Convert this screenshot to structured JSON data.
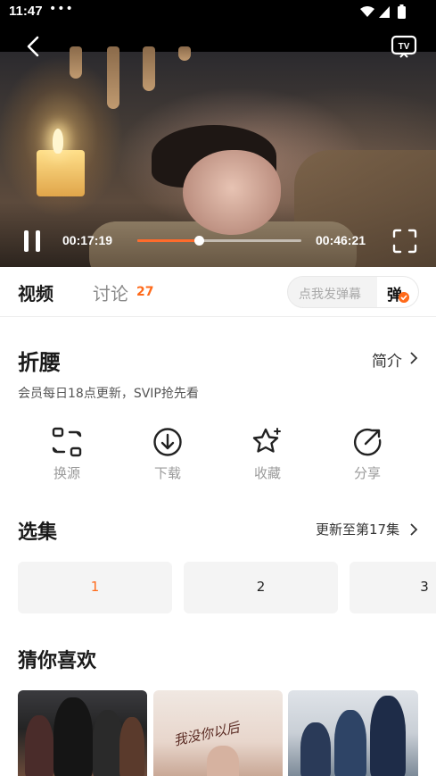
{
  "status_bar": {
    "time": "11:47",
    "dots": "•••"
  },
  "player": {
    "current_time": "00:17:19",
    "total_time": "00:46:21",
    "progress": 0.373
  },
  "tabs": {
    "video": "视频",
    "discuss": "讨论",
    "discuss_count": "27",
    "danmu_placeholder": "点我发弹幕",
    "danmu_toggle": "弹"
  },
  "show": {
    "title": "折腰",
    "intro_link": "简介",
    "subtitle": "会员每日18点更新，SVIP抢先看"
  },
  "actions": [
    {
      "label": "换源",
      "icon": "switch-source-icon"
    },
    {
      "label": "下载",
      "icon": "download-icon"
    },
    {
      "label": "收藏",
      "icon": "star-icon"
    },
    {
      "label": "分享",
      "icon": "share-icon"
    }
  ],
  "episodes": {
    "title": "选集",
    "update_text": "更新至第17集",
    "items": [
      "1",
      "2",
      "3"
    ],
    "selected": "1"
  },
  "recommendations": {
    "title": "猜你喜欢",
    "poster_script": "我没你以后"
  },
  "colors": {
    "accent": "#ff6a1a",
    "seek": "#ff6b2c"
  }
}
